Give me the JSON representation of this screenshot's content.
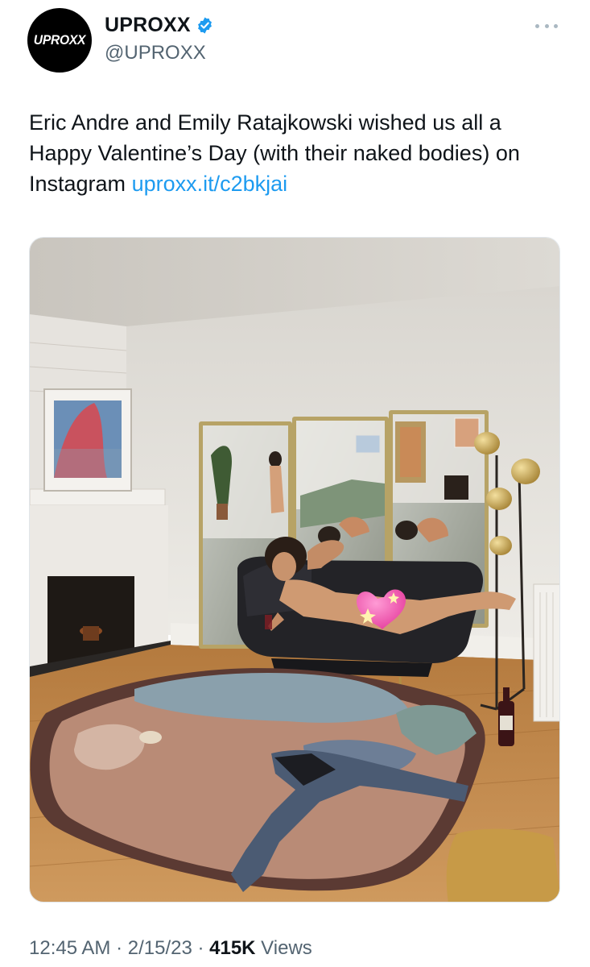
{
  "author": {
    "avatar_text": "UPROXX",
    "display_name": "UPROXX",
    "handle": "@UPROXX",
    "verified": true
  },
  "tweet": {
    "text": "Eric Andre and Emily Ratajkowski wished us all a Happy Valentine’s Day (with their naked bodies) on Instagram",
    "link_text": "uproxx.it/c2bkjai"
  },
  "meta": {
    "time": "12:45 AM",
    "separator_1": " · ",
    "date": "2/15/23",
    "separator_2": " · ",
    "views_count": "415K",
    "views_label": " Views"
  },
  "icons": {
    "more": "more-horizontal-icon",
    "verified": "verified-badge-icon"
  },
  "colors": {
    "link": "#1d9bf0",
    "secondary_text": "#536471",
    "verified": "#1d9bf0",
    "primary_text": "#0f1419"
  }
}
